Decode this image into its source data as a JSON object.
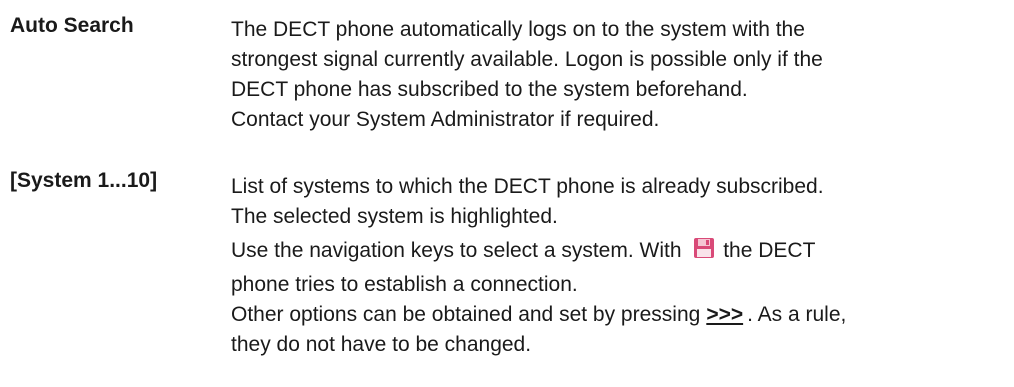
{
  "entries": [
    {
      "term": "Auto Search",
      "lines": [
        "The DECT phone automatically logs on to the system with the",
        "strongest signal currently available. Logon is possible only if the",
        "DECT phone has subscribed to the system beforehand.",
        "Contact your System Administrator if required."
      ]
    },
    {
      "term": "[System 1...10]",
      "lines": [
        "List of systems to which the DECT phone is already subscribed.",
        "The selected system is highlighted."
      ],
      "nav_line_before": "Use the navigation keys to select a system. With",
      "nav_line_after": "the DECT",
      "nav_line_2": "phone tries to establish a connection.",
      "options_before": "Other options can be obtained and set by pressing",
      "options_link": ">>>",
      "options_after": ". As a rule,",
      "last_line": "they do not have to be changed."
    }
  ],
  "icons": {
    "save": "save-icon",
    "save_color": "#d94a78"
  }
}
